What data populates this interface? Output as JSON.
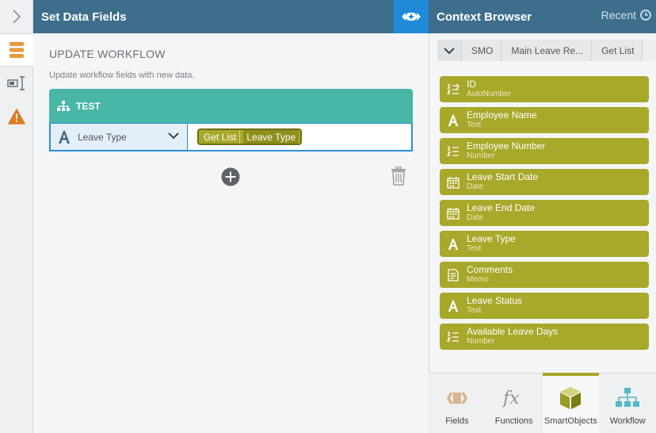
{
  "left_rail": {
    "expand_icon": "chevron-right-icon",
    "items": [
      {
        "icon": "stack-icon",
        "active": true
      },
      {
        "icon": "text-cursor-icon",
        "active": false
      },
      {
        "icon": "warning-icon",
        "active": false
      }
    ]
  },
  "main": {
    "header_title": "Set Data Fields",
    "section_title": "UPDATE WORKFLOW",
    "section_desc": "Update workflow fields with new data.",
    "card": {
      "title": "TEST",
      "mapping": {
        "field_label": "Leave Type",
        "token_source": "Get List",
        "token_field": "Leave Type"
      }
    }
  },
  "context_browser": {
    "title": "Context Browser",
    "recent_label": "Recent",
    "breadcrumbs": [
      "SMO",
      "Main Leave Re...",
      "Get List"
    ],
    "fields": [
      {
        "name": "ID",
        "type": "AutoNumber",
        "icon": "autonumber-icon"
      },
      {
        "name": "Employee Name",
        "type": "Text",
        "icon": "text-icon"
      },
      {
        "name": "Employee Number",
        "type": "Number",
        "icon": "number-icon"
      },
      {
        "name": "Leave Start Date",
        "type": "Date",
        "icon": "date-icon"
      },
      {
        "name": "Leave End Date",
        "type": "Date",
        "icon": "date-icon"
      },
      {
        "name": "Leave Type",
        "type": "Text",
        "icon": "text-icon"
      },
      {
        "name": "Comments",
        "type": "Memo",
        "icon": "memo-icon"
      },
      {
        "name": "Leave Status",
        "type": "Text",
        "icon": "text-icon"
      },
      {
        "name": "Available Leave Days",
        "type": "Number",
        "icon": "number-icon"
      }
    ],
    "tabs": [
      {
        "label": "Fields",
        "icon": "fields-icon",
        "active": false
      },
      {
        "label": "Functions",
        "icon": "fx-icon",
        "active": false
      },
      {
        "label": "SmartObjects",
        "icon": "cube-icon",
        "active": true
      },
      {
        "label": "Workflow",
        "icon": "workflow-icon",
        "active": false
      }
    ]
  },
  "colors": {
    "header": "#3d6f8d",
    "accent_blue": "#1f8ad8",
    "teal": "#48b7a7",
    "olive": "#a8a82a",
    "warning": "#e07b25",
    "rail_stack": "#e59a3c"
  }
}
